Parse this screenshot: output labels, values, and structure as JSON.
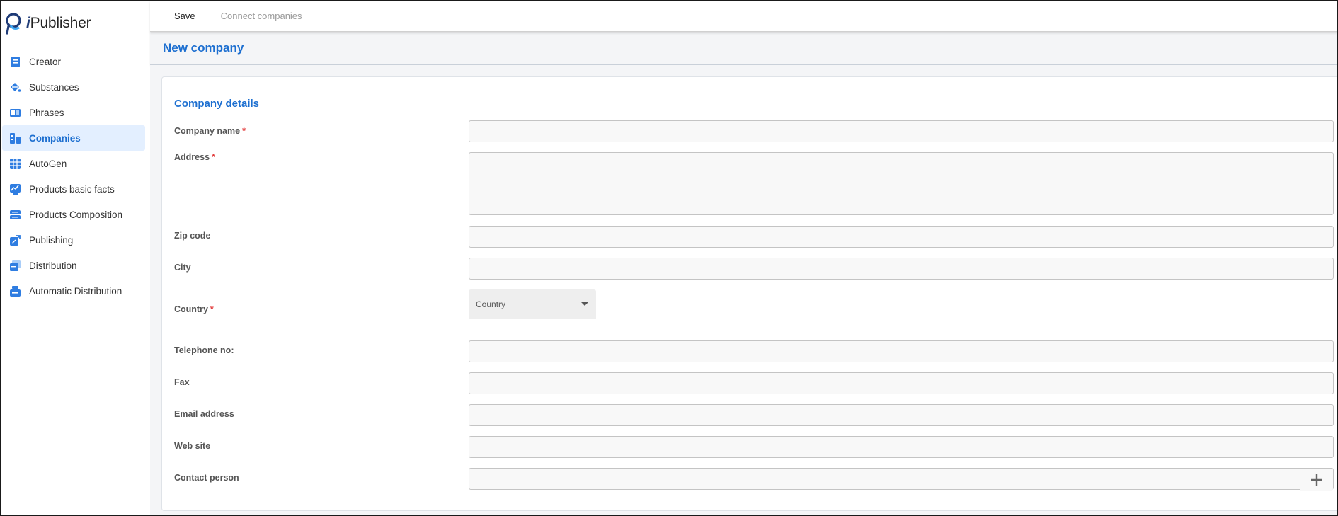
{
  "app": {
    "brand_prefix": "i",
    "brand_rest": "Publisher",
    "accent_color": "#1d6fd0"
  },
  "sidebar": {
    "items": [
      {
        "label": "Creator",
        "icon": "document-icon",
        "active": false
      },
      {
        "label": "Substances",
        "icon": "paint-bucket-icon",
        "active": false
      },
      {
        "label": "Phrases",
        "icon": "book-icon",
        "active": false
      },
      {
        "label": "Companies",
        "icon": "building-icon",
        "active": true
      },
      {
        "label": "AutoGen",
        "icon": "grid-icon",
        "active": false
      },
      {
        "label": "Products basic facts",
        "icon": "chart-icon",
        "active": false
      },
      {
        "label": "Products Composition",
        "icon": "layers-icon",
        "active": false
      },
      {
        "label": "Publishing",
        "icon": "publish-icon",
        "active": false
      },
      {
        "label": "Distribution",
        "icon": "distribution-icon",
        "active": false
      },
      {
        "label": "Automatic Distribution",
        "icon": "auto-distribution-icon",
        "active": false
      }
    ]
  },
  "toolbar": {
    "save_label": "Save",
    "connect_label": "Connect companies"
  },
  "header": {
    "title": "New company"
  },
  "form": {
    "section_title": "Company details",
    "required_marker": "*",
    "fields": {
      "company_name": {
        "label": "Company name",
        "value": "",
        "required": true
      },
      "address": {
        "label": "Address",
        "value": "",
        "required": true
      },
      "zip": {
        "label": "Zip code",
        "value": ""
      },
      "city": {
        "label": "City",
        "value": ""
      },
      "country": {
        "label": "Country",
        "required": true,
        "placeholder": "Country"
      },
      "telephone": {
        "label": "Telephone no:",
        "value": ""
      },
      "fax": {
        "label": "Fax",
        "value": ""
      },
      "email": {
        "label": "Email address",
        "value": ""
      },
      "website": {
        "label": "Web site",
        "value": ""
      },
      "contact": {
        "label": "Contact person",
        "value": "",
        "add_icon": "plus-icon"
      }
    }
  }
}
